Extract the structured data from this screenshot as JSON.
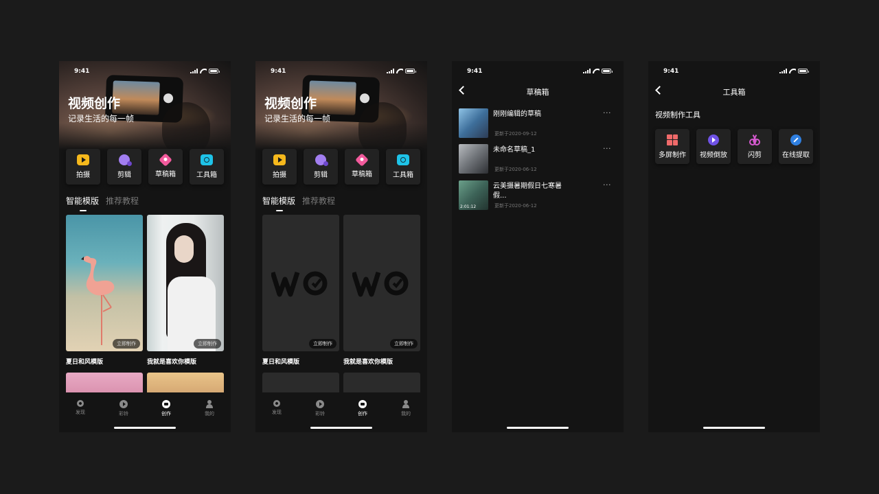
{
  "status": {
    "time": "9:41"
  },
  "create": {
    "hero_title": "视频创作",
    "hero_subtitle": "记录生活的每一帧",
    "actions": [
      {
        "label": "拍摄",
        "icon": "video-camera-icon",
        "color": "#f5b81c"
      },
      {
        "label": "剪辑",
        "icon": "edit-clip-icon",
        "color": "#a27ef0"
      },
      {
        "label": "草稿箱",
        "icon": "drafts-icon",
        "color": "#f25a9c"
      },
      {
        "label": "工具箱",
        "icon": "toolbox-icon",
        "color": "#1ec3e8"
      }
    ],
    "tabs": {
      "active": "智能模版",
      "inactive": "推荐教程"
    },
    "cta": "立即制作",
    "templates": [
      {
        "title": "夏日和风模版"
      },
      {
        "title": "我就是喜欢你模版"
      }
    ],
    "placeholder_logo": "WO"
  },
  "nav": [
    {
      "label": "发现",
      "icon": "eye-icon",
      "active": false
    },
    {
      "label": "彩铃",
      "icon": "play-icon",
      "active": false
    },
    {
      "label": "创作",
      "icon": "camera-icon",
      "active": true
    },
    {
      "label": "我的",
      "icon": "user-icon",
      "active": false
    }
  ],
  "drafts": {
    "title": "草稿箱",
    "more": "···",
    "items": [
      {
        "name": "刚刚编辑的草稿",
        "date": "更新于2020-09-12",
        "duration": ""
      },
      {
        "name": "未命名草稿_1",
        "date": "更新于2020-06-12",
        "duration": ""
      },
      {
        "name": "云美摄暑期假日七寒暑假...",
        "date": "更新于2020-06-12",
        "duration": "2:01:12"
      }
    ]
  },
  "toolbox": {
    "title": "工具箱",
    "section": "视频制作工具",
    "tools": [
      {
        "label": "多屏制作",
        "icon": "multi-screen-icon",
        "color": "#f06a6a"
      },
      {
        "label": "视频倒放",
        "icon": "reverse-play-icon",
        "color": "#6f52e6"
      },
      {
        "label": "闪剪",
        "icon": "scissors-icon",
        "color": "#d65ad0"
      },
      {
        "label": "在线提取",
        "icon": "link-extract-icon",
        "color": "#2f7fe0"
      }
    ]
  }
}
